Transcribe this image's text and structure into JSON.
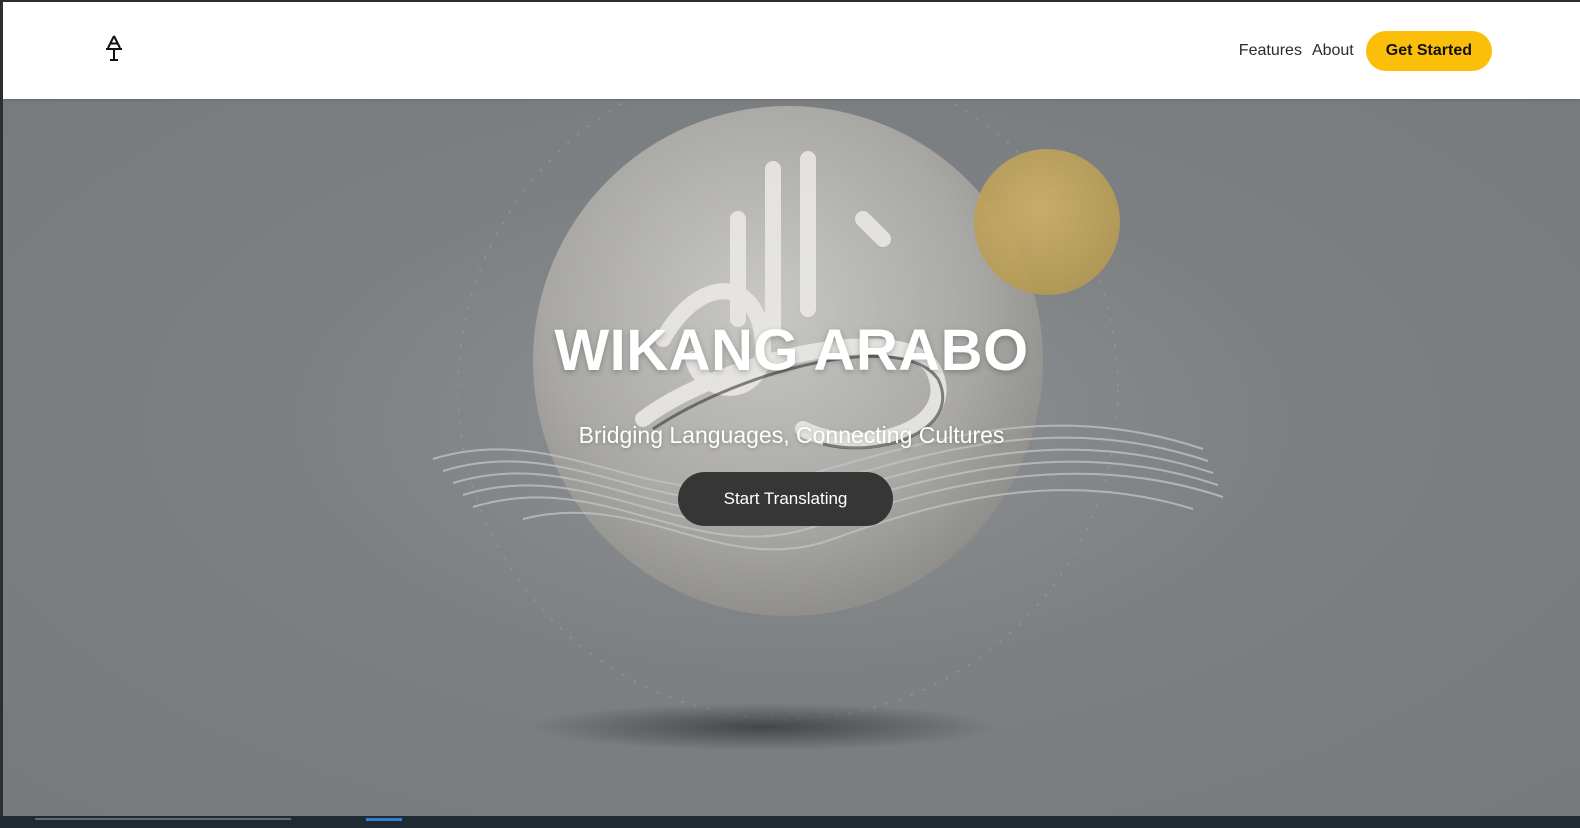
{
  "header": {
    "logo_icon": "at-monogram-icon",
    "nav": {
      "features_label": "Features",
      "about_label": "About",
      "cta_label": "Get Started"
    }
  },
  "hero": {
    "title": "WIKANG ARABO",
    "subtitle": "Bridging Languages, Connecting Cultures",
    "button_label": "Start Translating"
  },
  "colors": {
    "accent": "#fbbf0a",
    "hero_button": "#363636",
    "hero_background": "#7b7e80"
  }
}
